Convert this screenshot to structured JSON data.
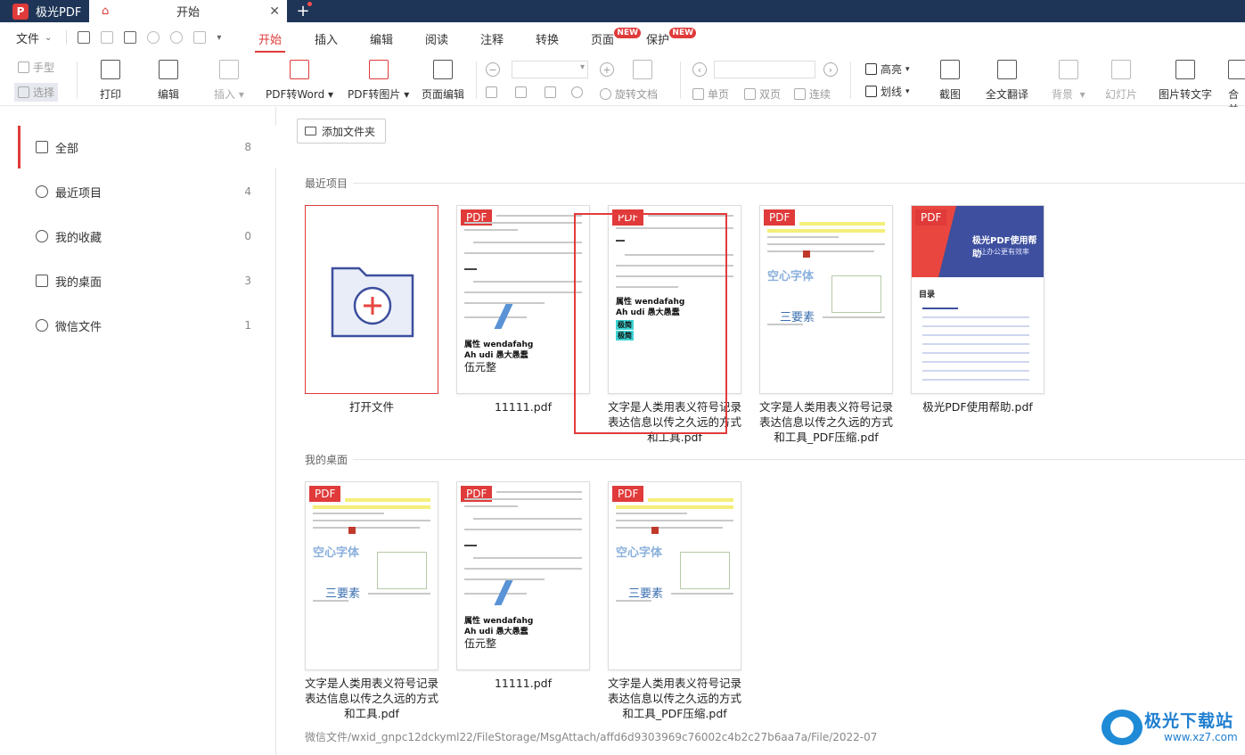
{
  "titlebar": {
    "app_name": "极光PDF",
    "home_tab_label": "开始",
    "close_glyph": "✕",
    "new_tab_glyph": "+"
  },
  "menubar": {
    "file_label": "文件",
    "tabs": [
      {
        "label": "开始",
        "active": true
      },
      {
        "label": "插入"
      },
      {
        "label": "编辑"
      },
      {
        "label": "阅读"
      },
      {
        "label": "注释"
      },
      {
        "label": "转换"
      },
      {
        "label": "页面",
        "badge": "NEW"
      },
      {
        "label": "保护",
        "badge": "NEW"
      }
    ]
  },
  "toolbar": {
    "hand": "手型",
    "select": "选择",
    "print": "打印",
    "edit": "编辑",
    "insert": "插入",
    "pdf_to_word": "PDF转Word",
    "pdf_to_image": "PDF转图片",
    "page_edit": "页面编辑",
    "rotate_doc": "旋转文档",
    "single_page": "单页",
    "double_page": "双页",
    "continuous": "连续",
    "highlight": "高亮",
    "underline": "划线",
    "screenshot": "截图",
    "full_translate": "全文翻译",
    "background": "背景",
    "slideshow": "幻灯片",
    "image_to_text": "图片转文字",
    "merge_partial": "合并"
  },
  "sidebar": {
    "items": [
      {
        "label": "全部",
        "count": "8",
        "icon": "grid-icon"
      },
      {
        "label": "最近项目",
        "count": "4",
        "icon": "clock-icon"
      },
      {
        "label": "我的收藏",
        "count": "0",
        "icon": "heart-icon"
      },
      {
        "label": "我的桌面",
        "count": "3",
        "icon": "monitor-icon"
      },
      {
        "label": "微信文件",
        "count": "1",
        "icon": "wechat-icon"
      }
    ]
  },
  "main": {
    "add_folder": "添加文件夹",
    "recent_title": "最近项目",
    "desktop_title": "我的桌面",
    "badge": "PDF",
    "recent_files": [
      {
        "name": "打开文件"
      },
      {
        "name": "11111.pdf"
      },
      {
        "name": "文字是人类用表义符号记录表达信息以传之久远的方式和工具.pdf"
      },
      {
        "name": "文字是人类用表义符号记录表达信息以传之久远的方式和工具_PDF压缩.pdf"
      },
      {
        "name": "极光PDF使用帮助.pdf"
      }
    ],
    "desktop_files": [
      {
        "name": "文字是人类用表义符号记录表达信息以传之久远的方式和工具.pdf"
      },
      {
        "name": "11111.pdf"
      },
      {
        "name": "文字是人类用表义符号记录表达信息以传之久远的方式和工具_PDF压缩.pdf"
      }
    ],
    "wechat_path": "微信文件/wxid_gnpc12dckyml22/FileStorage/MsgAttach/affd6d9303969c76002c4b2c27b6aa7a/File/2022-07"
  },
  "thumb_text": {
    "attr": "属性 wendafahg",
    "ahudi": "Ah udi 愚大愚蠢",
    "wuyuan": "伍元整",
    "hollow": "空心字体",
    "three": "三要素",
    "help_title": "极光PDF使用帮助",
    "help_sub": "让办公更有效率",
    "toc": "目录",
    "cyan1": "极简",
    "cyan2": "极简"
  },
  "watermark": {
    "line1": "极光下载站",
    "line2": "www.xz7.com"
  },
  "colors": {
    "accent": "#e03a3a",
    "titlebar": "#1e3557",
    "annotation": "#e33b3b"
  }
}
